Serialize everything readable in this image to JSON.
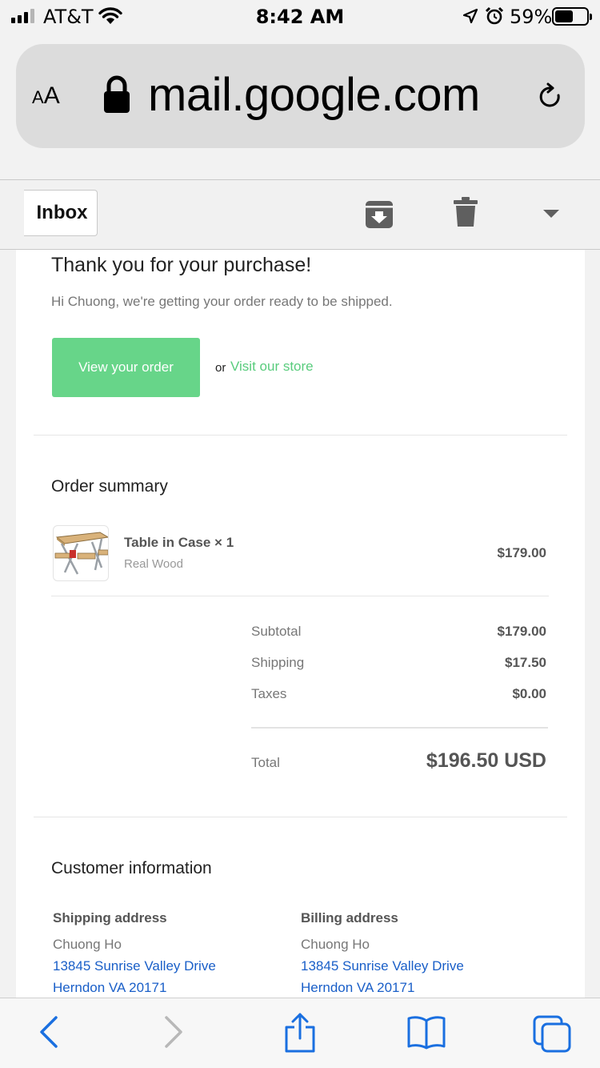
{
  "status_bar": {
    "carrier": "AT&T",
    "time": "8:42 AM",
    "battery": "59%",
    "battery_level": 0.59,
    "icons": [
      "signal-icon",
      "wifi-icon",
      "location-icon",
      "alarm-icon",
      "battery-icon"
    ]
  },
  "address_bar": {
    "text_size_label_small": "A",
    "text_size_label_large": "A",
    "url": "mail.google.com",
    "icons": [
      "lock-icon",
      "reload-icon"
    ]
  },
  "toolbar": {
    "back_label": "Inbox",
    "icons": [
      "archive-icon",
      "delete-icon",
      "more-icon"
    ]
  },
  "email": {
    "heading": "Thank you for your purchase!",
    "greeting": "Hi Chuong, we're getting your order ready to be shipped.",
    "view_order_button": "View your order",
    "or_text": "or",
    "store_link": "Visit our store",
    "accent_color": "#67d589",
    "order_summary": {
      "title": "Order summary",
      "item": {
        "name": "Table in Case × 1",
        "variant": "Real Wood",
        "price": "$179.00"
      },
      "rows": [
        {
          "label": "Subtotal",
          "value": "$179.00"
        },
        {
          "label": "Shipping",
          "value": "$17.50"
        },
        {
          "label": "Taxes",
          "value": "$0.00"
        }
      ],
      "total_label": "Total",
      "total_value": "$196.50 USD"
    },
    "customer_info": {
      "title": "Customer information",
      "shipping": {
        "heading": "Shipping address",
        "name": "Chuong Ho",
        "line1": "13845 Sunrise Valley Drive",
        "line2": "Herndon VA 20171"
      },
      "billing": {
        "heading": "Billing address",
        "name": "Chuong Ho",
        "line1": "13845 Sunrise Valley Drive",
        "line2": "Herndon VA 20171"
      }
    }
  },
  "bottom_bar": {
    "icons": [
      "back-icon",
      "forward-icon",
      "share-icon",
      "bookmarks-icon",
      "tabs-icon"
    ],
    "link_color": "#1a6fe0"
  }
}
